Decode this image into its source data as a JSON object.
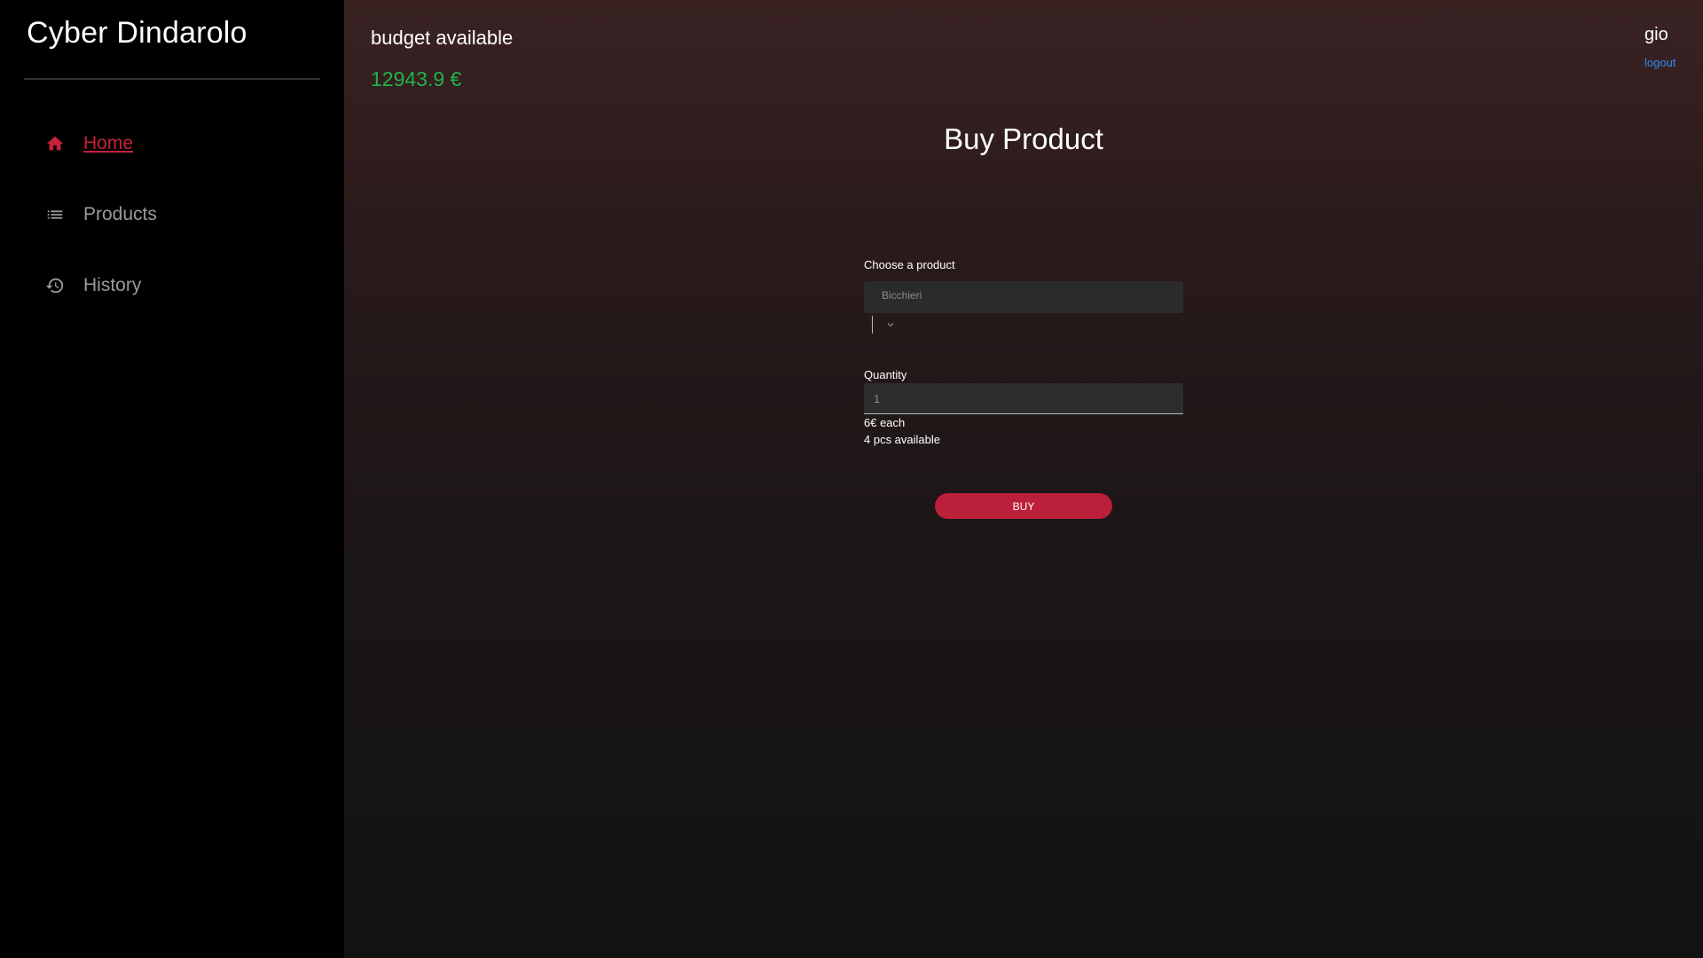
{
  "sidebar": {
    "brand": "Cyber Dindarolo",
    "items": [
      {
        "label": "Home",
        "icon": "home-icon",
        "active": true
      },
      {
        "label": "Products",
        "icon": "list-icon",
        "active": false
      },
      {
        "label": "History",
        "icon": "history-icon",
        "active": false
      }
    ]
  },
  "header": {
    "budget_title": "budget available",
    "budget_value": "12943.9 €",
    "user_name": "gio",
    "logout_label": "logout"
  },
  "main": {
    "title": "Buy Product",
    "product_label": "Choose a product",
    "product_selected": "Bicchieri",
    "quantity_label": "Quantity",
    "quantity_value": "1",
    "price_note": "6€ each",
    "stock_note": "4 pcs available",
    "buy_label": "BUY"
  },
  "colors": {
    "accent": "#c7213b",
    "budget": "#22b24c",
    "link": "#2d8cf0",
    "button": "#bb1f3a"
  }
}
